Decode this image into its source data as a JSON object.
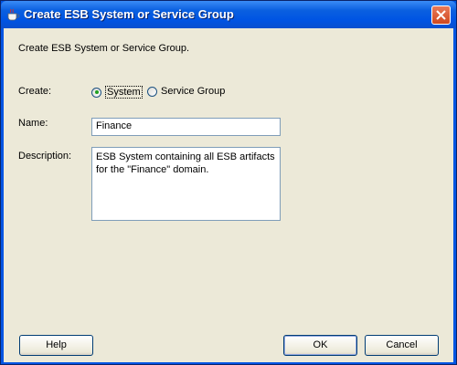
{
  "window": {
    "title": "Create ESB System or Service Group",
    "icon": "coffee-cup-icon"
  },
  "dialog": {
    "intro_text": "Create ESB System or Service Group.",
    "create_label": "Create:",
    "create_options": [
      {
        "label": "System",
        "selected": true
      },
      {
        "label": "Service Group",
        "selected": false
      }
    ],
    "name_label": "Name:",
    "name_value": "Finance",
    "description_label": "Description:",
    "description_value": "ESB System containing all ESB artifacts\nfor the \"Finance\" domain."
  },
  "buttons": {
    "help": "Help",
    "ok": "OK",
    "cancel": "Cancel"
  }
}
